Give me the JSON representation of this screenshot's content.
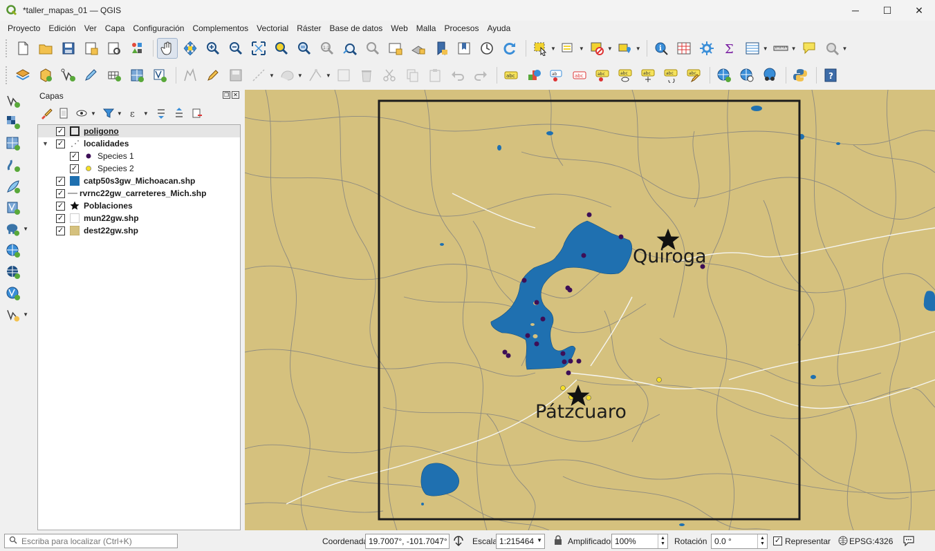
{
  "window": {
    "title": "*taller_mapas_01 — QGIS",
    "minimize_glyph": "─",
    "maximize_glyph": "☐",
    "close_glyph": "✕"
  },
  "menu": [
    "Proyecto",
    "Edición",
    "Ver",
    "Capa",
    "Configuración",
    "Complementos",
    "Vectorial",
    "Ráster",
    "Base de datos",
    "Web",
    "Malla",
    "Procesos",
    "Ayuda"
  ],
  "panel": {
    "title": "Capas"
  },
  "layers": [
    {
      "name": "poligono",
      "checked": true,
      "symbol": "polygon-outline-icon",
      "style": "bold-underline"
    },
    {
      "name": "localidades",
      "checked": true,
      "symbol": "categorized-points-icon",
      "style": "bold",
      "expanded": true
    },
    {
      "name": "Species 1",
      "checked": true,
      "symbol": "species1-point-icon",
      "color": "#3d0f57",
      "child": true
    },
    {
      "name": "Species 2",
      "checked": true,
      "symbol": "species2-point-icon",
      "color": "#f5df26",
      "child": true
    },
    {
      "name": "catp50s3gw_Michoacan.shp",
      "checked": true,
      "symbol": "water-polygon-icon",
      "color": "#1f70b0",
      "style": "bold"
    },
    {
      "name": "rvrnc22gw_carreteres_Mich.shp",
      "checked": true,
      "symbol": "line-icon",
      "style": "bold"
    },
    {
      "name": "Poblaciones",
      "checked": true,
      "symbol": "star-icon",
      "style": "bold"
    },
    {
      "name": "mun22gw.shp",
      "checked": true,
      "symbol": "empty-polygon-icon",
      "style": "bold"
    },
    {
      "name": "dest22gw.shp",
      "checked": true,
      "symbol": "tan-polygon-icon",
      "color": "#d5c17e",
      "style": "bold"
    }
  ],
  "map": {
    "background": "#d5c17e",
    "water_color": "#1f70b0",
    "places": [
      {
        "name": "Quiroga"
      },
      {
        "name": "Pátzcuaro"
      }
    ]
  },
  "statusbar": {
    "locator_placeholder": "Escriba para localizar (Ctrl+K)",
    "coord_label": "Coordenada",
    "coord_value": "19.7007°, -101.7047°",
    "scale_label": "Escala",
    "scale_value": "1:215464",
    "magnifier_label": "Amplificador",
    "magnifier_value": "100%",
    "rotation_label": "Rotación",
    "rotation_value": "0.0 °",
    "render_label": "Representar",
    "render_checked": true,
    "crs": "EPSG:4326"
  }
}
